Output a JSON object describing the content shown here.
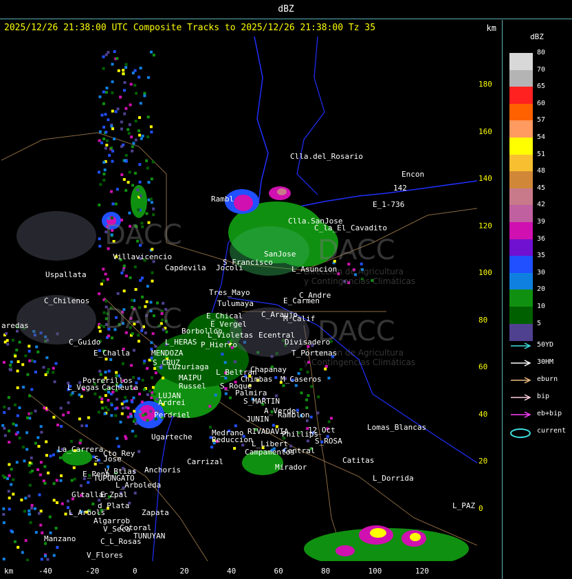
{
  "window": {
    "title": "dBZ"
  },
  "header": {
    "title": "2025/12/26 21:38:00 UTC Composite Tracks to 2025/12/26 21:38:00 Tz 35",
    "unit_label": "km"
  },
  "axes": {
    "x_unit": "km",
    "y_ticks": [
      "180",
      "160",
      "140",
      "120",
      "100",
      "80",
      "60",
      "40",
      "20",
      "0"
    ],
    "x_ticks": [
      "-40",
      "-20",
      "0",
      "20",
      "40",
      "60",
      "80",
      "100",
      "120"
    ]
  },
  "scale": {
    "unit": "dBZ",
    "levels": [
      {
        "label": "80",
        "color": "#d8d8d8"
      },
      {
        "label": "70",
        "color": "#b4b4b4"
      },
      {
        "label": "65",
        "color": "#ff2020"
      },
      {
        "label": "60",
        "color": "#ff6000"
      },
      {
        "label": "57",
        "color": "#ff9a60"
      },
      {
        "label": "54",
        "color": "#ffff00"
      },
      {
        "label": "51",
        "color": "#f8c030"
      },
      {
        "label": "48",
        "color": "#d08838"
      },
      {
        "label": "45",
        "color": "#c87a8a"
      },
      {
        "label": "42",
        "color": "#c060a0"
      },
      {
        "label": "39",
        "color": "#d010b0"
      },
      {
        "label": "36",
        "color": "#7010d0"
      },
      {
        "label": "35",
        "color": "#2050ff"
      },
      {
        "label": "30",
        "color": "#1080e0"
      },
      {
        "label": "20",
        "color": "#109010"
      },
      {
        "label": "10",
        "color": "#006000"
      },
      {
        "label": "5",
        "color": "#504090"
      }
    ]
  },
  "legend": [
    {
      "label": "50YD",
      "color": "#40e0e0"
    },
    {
      "label": "30HM",
      "color": "#ffffff"
    },
    {
      "label": "eburn",
      "color": "#f0c080"
    },
    {
      "label": "bip",
      "color": "#ffd0e0"
    },
    {
      "label": "eb+bip",
      "color": "#ff40ff"
    },
    {
      "label": "current",
      "color": "#40e0e0"
    }
  ],
  "places": [
    {
      "name": "Clla.del_Rosario"
    },
    {
      "name": "Encon"
    },
    {
      "name": "142"
    },
    {
      "name": "E_1-736"
    },
    {
      "name": "Rambl"
    },
    {
      "name": "Clla.SanJose"
    },
    {
      "name": "C_la_El_Cavadito"
    },
    {
      "name": "Villavicencio"
    },
    {
      "name": "Capdevila"
    },
    {
      "name": "Uspallata"
    },
    {
      "name": "S_Francisco"
    },
    {
      "name": "Jocoli"
    },
    {
      "name": "SanJose"
    },
    {
      "name": "L_Asuncion"
    },
    {
      "name": "Tres_Mayo"
    },
    {
      "name": "C_Andre"
    },
    {
      "name": "Tulumaya"
    },
    {
      "name": "E_Carmen"
    },
    {
      "name": "C_Chilenos"
    },
    {
      "name": "E_Chical"
    },
    {
      "name": "C_Araujo"
    },
    {
      "name": "M_Calif"
    },
    {
      "name": "E_Vergel"
    },
    {
      "name": "Borbollon"
    },
    {
      "name": "Ecentral"
    },
    {
      "name": "L_Violetas"
    },
    {
      "name": "Divisadero"
    },
    {
      "name": "aredas"
    },
    {
      "name": "C_Guido"
    },
    {
      "name": "L_HERAS"
    },
    {
      "name": "P_Hierro"
    },
    {
      "name": "T_Portenas"
    },
    {
      "name": "E_Challa"
    },
    {
      "name": "MENDOZA"
    },
    {
      "name": "S_CRUZ"
    },
    {
      "name": "Luzuriaga"
    },
    {
      "name": "Chapanay"
    },
    {
      "name": "L_Beltran"
    },
    {
      "name": "Potrerillos"
    },
    {
      "name": "MAIPU"
    },
    {
      "name": "Chimbas"
    },
    {
      "name": "M_Caseros"
    },
    {
      "name": "L_Vegas"
    },
    {
      "name": "Cacheuta"
    },
    {
      "name": "Russel"
    },
    {
      "name": "S_Roque"
    },
    {
      "name": "LUJAN"
    },
    {
      "name": "Palmira"
    },
    {
      "name": "Ardrei"
    },
    {
      "name": "S_MARTIN"
    },
    {
      "name": "A_Verde"
    },
    {
      "name": "Ramblon"
    },
    {
      "name": "Perdriel"
    },
    {
      "name": "Ugarteche"
    },
    {
      "name": "JUNIN"
    },
    {
      "name": "RIVADAVIA"
    },
    {
      "name": "12_Oct"
    },
    {
      "name": "Lomas_Blancas"
    },
    {
      "name": "L_Libert"
    },
    {
      "name": "Phillips"
    },
    {
      "name": "S_ROSA"
    },
    {
      "name": "Medrano"
    },
    {
      "name": "Reduccion"
    },
    {
      "name": "La_Carrera"
    },
    {
      "name": "Cto_Rey"
    },
    {
      "name": "S_Jose"
    },
    {
      "name": "Carrizal"
    },
    {
      "name": "Campamentos"
    },
    {
      "name": "Central"
    },
    {
      "name": "Catitas"
    },
    {
      "name": "Anchoris"
    },
    {
      "name": "Mirador"
    },
    {
      "name": "E_Pena"
    },
    {
      "name": "V_Btias"
    },
    {
      "name": "TUPUNGATO"
    },
    {
      "name": "L_Dorrida"
    },
    {
      "name": "L_Arboleda"
    },
    {
      "name": "Gltallar"
    },
    {
      "name": "E_Zpal"
    },
    {
      "name": "L_Arbols"
    },
    {
      "name": "d_Plata"
    },
    {
      "name": "Zapata"
    },
    {
      "name": "L_PAZ"
    },
    {
      "name": "Algarrob"
    },
    {
      "name": "V_Seca"
    },
    {
      "name": "Cotoral"
    },
    {
      "name": "TUNUYAN"
    },
    {
      "name": "Manzano"
    },
    {
      "name": "C_L_Rosas"
    },
    {
      "name": "V_Flores"
    }
  ],
  "watermark": {
    "brand": "DACC",
    "line1": "Dirección de Agricultura",
    "line2": "y Contingencias Climáticas"
  }
}
